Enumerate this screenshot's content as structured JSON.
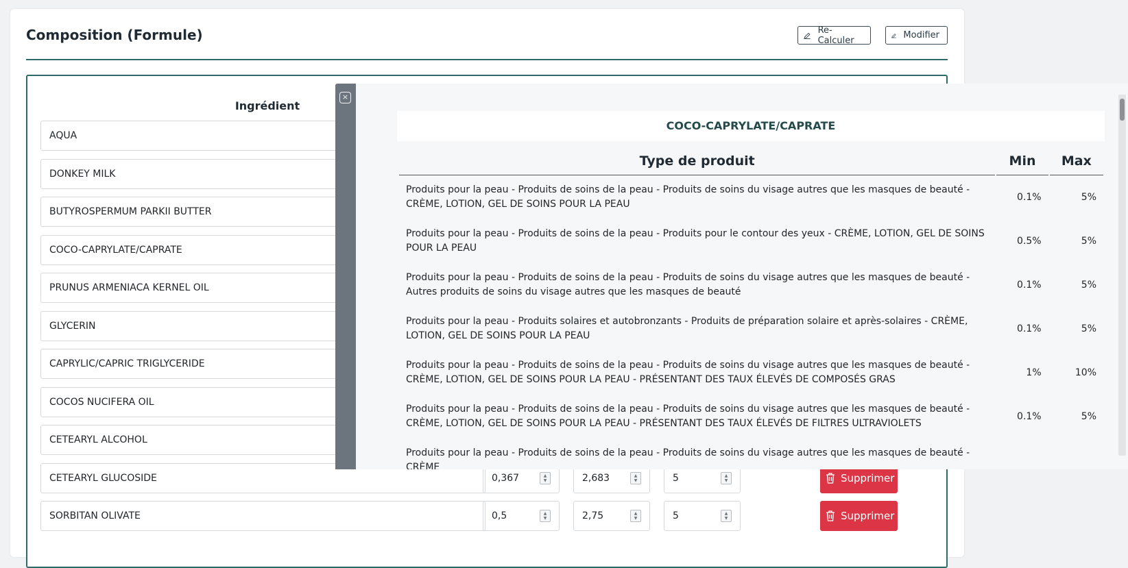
{
  "page": {
    "title": "Composition (Formule)",
    "recalc_label": "Re-Calculer",
    "modify_label": "Modifier"
  },
  "table": {
    "ingredient_header": "Ingrédient",
    "delete_label": "Supprimer",
    "rows": [
      {
        "name": "AQUA"
      },
      {
        "name": "DONKEY MILK"
      },
      {
        "name": "BUTYROSPERMUM PARKII BUTTER"
      },
      {
        "name": "COCO-CAPRYLATE/CAPRATE"
      },
      {
        "name": "PRUNUS ARMENIACA KERNEL OIL"
      },
      {
        "name": "GLYCERIN"
      },
      {
        "name": "CAPRYLIC/CAPRIC TRIGLYCERIDE"
      },
      {
        "name": "COCOS NUCIFERA OIL"
      },
      {
        "name": "CETEARYL ALCOHOL"
      },
      {
        "name": "CETEARYL GLUCOSIDE",
        "v1": "0,367",
        "v2": "2,683",
        "v3": "5"
      },
      {
        "name": "SORBITAN OLIVATE",
        "v1": "0,5",
        "v2": "2,75",
        "v3": "5"
      }
    ]
  },
  "modal": {
    "ingredient": "COCO-CAPRYLATE/CAPRATE",
    "close_icon": "×",
    "headers": {
      "type": "Type de produit",
      "min": "Min",
      "max": "Max"
    },
    "rows": [
      {
        "type": "Produits pour la peau - Produits de soins de la peau - Produits de soins du visage autres que les masques de beauté - CRÈME, LOTION, GEL DE SOINS POUR LA PEAU",
        "min": "0.1%",
        "max": "5%"
      },
      {
        "type": "Produits pour la peau - Produits de soins de la peau - Produits pour le contour des yeux - CRÈME, LOTION, GEL DE SOINS POUR LA PEAU",
        "min": "0.5%",
        "max": "5%"
      },
      {
        "type": "Produits pour la peau - Produits de soins de la peau - Produits de soins du visage autres que les masques de beauté - Autres produits de soins du visage autres que les masques de beauté",
        "min": "0.1%",
        "max": "5%"
      },
      {
        "type": "Produits pour la peau - Produits solaires et autobronzants - Produits de préparation solaire et après-solaires - CRÈME, LOTION, GEL DE SOINS POUR LA PEAU",
        "min": "0.1%",
        "max": "5%"
      },
      {
        "type": "Produits pour la peau - Produits de soins de la peau - Produits de soins du visage autres que les masques de beauté - CRÈME, LOTION, GEL DE SOINS POUR LA PEAU - PRÉSENTANT DES TAUX ÉLEVÉS DE COMPOSÉS GRAS",
        "min": "1%",
        "max": "10%"
      },
      {
        "type": "Produits pour la peau - Produits de soins de la peau - Produits de soins du visage autres que les masques de beauté - CRÈME, LOTION, GEL DE SOINS POUR LA PEAU - PRÉSENTANT DES TAUX ÉLEVÉS DE FILTRES ULTRAVIOLETS",
        "min": "0.1%",
        "max": "5%"
      },
      {
        "type": "Produits pour la peau - Produits de soins de la peau - Produits de soins du visage autres que les masques de beauté - CRÈME",
        "min": "",
        "max": ""
      }
    ]
  },
  "colors": {
    "accent": "#2d6b6a",
    "danger": "#dc3545",
    "modal_side": "#6c757d"
  }
}
